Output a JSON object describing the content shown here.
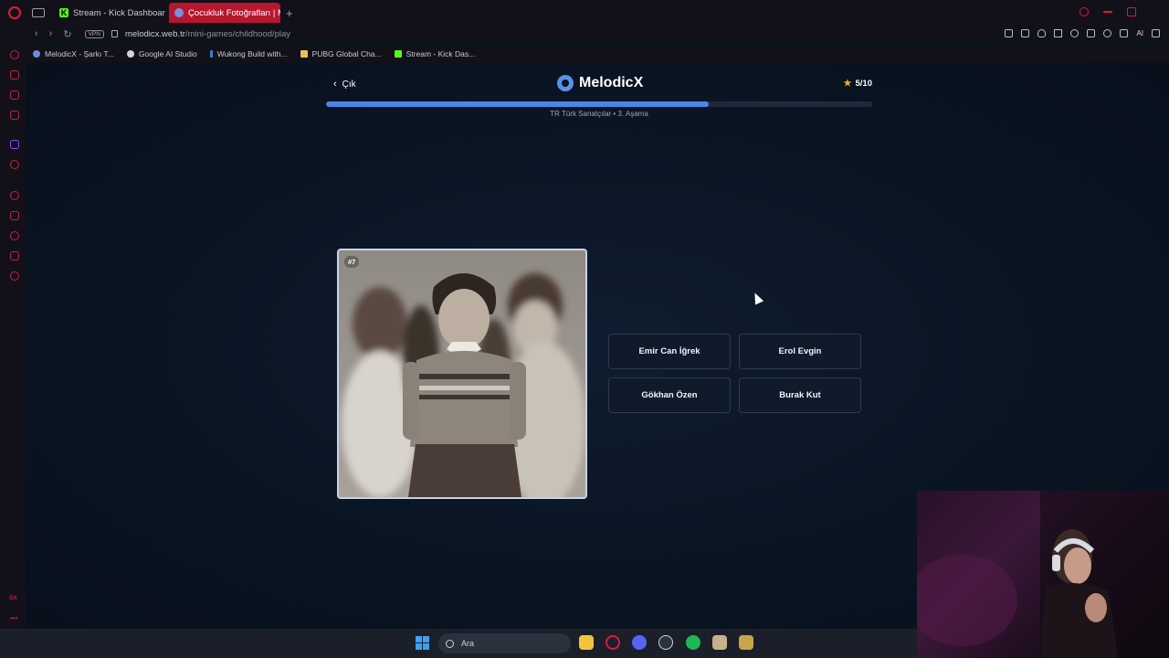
{
  "browser": {
    "tabs": [
      {
        "label": "Stream - Kick Dashboard",
        "active": false
      },
      {
        "label": "Çocukluk Fotoğrafları | Me",
        "active": true
      }
    ],
    "address": {
      "domain": "melodicx.web.tr",
      "path": "/mini-games/childhood/play",
      "vpn_label": "VPN"
    },
    "bookmarks": [
      {
        "label": "MelodicX - Şarkı T..."
      },
      {
        "label": "Google AI Studio"
      },
      {
        "label": "Wukong Build with..."
      },
      {
        "label": "PUBG Global Cha..."
      },
      {
        "label": "Stream - Kick Das..."
      }
    ],
    "ai_label": "AI",
    "sidebar_gx_label": "GX"
  },
  "game": {
    "exit_label": "Çık",
    "brand": "MelodicX",
    "score": "5/10",
    "progress": 0.7,
    "stage": "TR Türk Sanatçılar • 3. Aşama",
    "photo_badge": "#7",
    "answers": [
      "Emir Can İğrek",
      "Erol Evgin",
      "Gökhan Özen",
      "Burak Kut"
    ]
  },
  "taskbar": {
    "search_placeholder": "Ara"
  },
  "colors": {
    "accent": "#4a86e8",
    "brand_red": "#b5172f",
    "trophy": "#e8b22b",
    "page_bg": "#0a1422"
  }
}
